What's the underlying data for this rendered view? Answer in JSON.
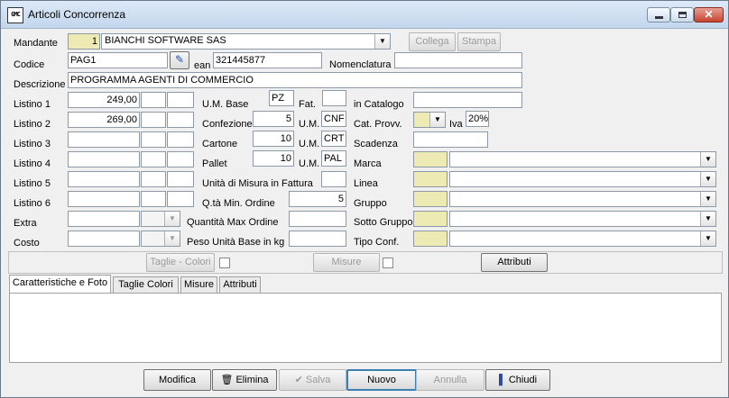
{
  "window": {
    "title": "Articoli Concorrenza",
    "app_icon_text": "GMC"
  },
  "header": {
    "mandante_label": "Mandante",
    "mandante_code": "1",
    "mandante_name": "BIANCHI SOFTWARE SAS",
    "collega": "Collega",
    "stampa": "Stampa",
    "codice_label": "Codice",
    "codice": "PAG1",
    "ean_label": "ean",
    "ean": "321445877",
    "nomenclatura_label": "Nomenclatura",
    "nomenclatura": "",
    "descrizione_label": "Descrizione",
    "descrizione": "PROGRAMMA AGENTI DI COMMERCIO"
  },
  "listini": [
    {
      "label": "Listino 1",
      "value": "249,00"
    },
    {
      "label": "Listino 2",
      "value": "269,00"
    },
    {
      "label": "Listino 3",
      "value": ""
    },
    {
      "label": "Listino 4",
      "value": ""
    },
    {
      "label": "Listino 5",
      "value": ""
    },
    {
      "label": "Listino 6",
      "value": ""
    },
    {
      "label": "Extra",
      "value": ""
    },
    {
      "label": "Costo",
      "value": ""
    }
  ],
  "units": {
    "um_base_label": "U.M. Base",
    "um_base": "PZ",
    "fat_label": "Fat.",
    "fat": "",
    "confezione_label": "Confezione",
    "confezione": "5",
    "confezione_um": "CNF",
    "cartone_label": "Cartone",
    "cartone": "10",
    "cartone_um": "CRT",
    "pallet_label": "Pallet",
    "pallet": "10",
    "pallet_um": "PAL",
    "um_label": "U.M.",
    "um_fattura_label": "Unità di Misura in Fattura",
    "um_fattura": "",
    "qta_min_label": "Q.tà Min. Ordine",
    "qta_min": "5",
    "qta_max_label": "Quantità Max Ordine",
    "qta_max": "",
    "peso_label": "Peso Unità Base in kg",
    "peso": ""
  },
  "catalog": {
    "in_catalogo_label": "in Catalogo",
    "in_catalogo": "",
    "cat_provv_label": "Cat. Provv.",
    "cat_provv": "",
    "iva_label": "Iva",
    "iva": "20%",
    "scadenza_label": "Scadenza",
    "scadenza": "",
    "marca_label": "Marca",
    "linea_label": "Linea",
    "gruppo_label": "Gruppo",
    "sotto_gruppo_label": "Sotto Gruppo",
    "tipo_conf_label": "Tipo Conf."
  },
  "options_bar": {
    "taglie_colori": "Taglie - Colori",
    "misure": "Misure",
    "attributi": "Attributi"
  },
  "tabs": [
    "Caratteristiche e Foto",
    "Taglie Colori",
    "Misure",
    "Attributi"
  ],
  "actions": {
    "modifica": "Modifica",
    "elimina": "Elimina",
    "salva": "Salva",
    "nuovo": "Nuovo",
    "annulla": "Annulla",
    "chiudi": "Chiudi"
  }
}
